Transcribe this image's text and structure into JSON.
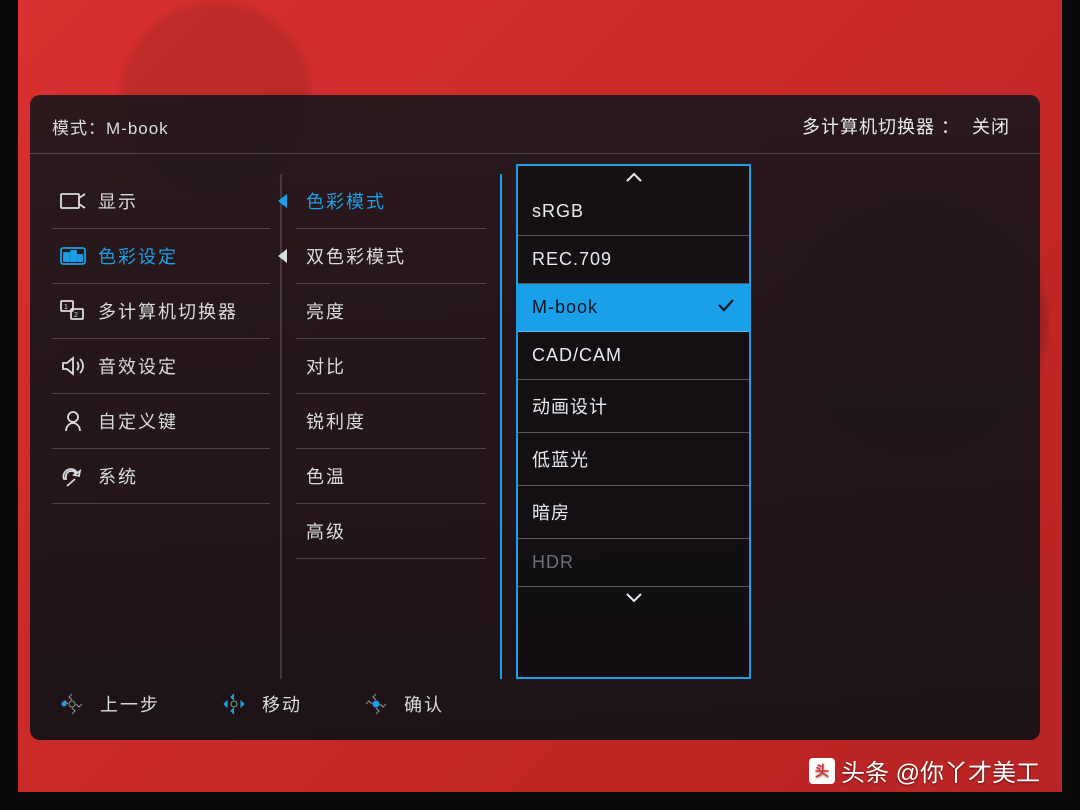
{
  "header": {
    "mode_prefix": "模式：",
    "mode_value": "M-book",
    "kvm_label": "多计算机切换器 ：",
    "kvm_value": "关闭"
  },
  "main_menu": [
    {
      "label": "显示",
      "icon": "display-icon"
    },
    {
      "label": "色彩设定",
      "icon": "color-icon"
    },
    {
      "label": "多计算机切换器",
      "icon": "kvm-icon"
    },
    {
      "label": "音效设定",
      "icon": "audio-icon"
    },
    {
      "label": "自定义键",
      "icon": "custom-key-icon"
    },
    {
      "label": "系统",
      "icon": "system-icon"
    }
  ],
  "main_menu_active": 1,
  "sub_menu": [
    "色彩模式",
    "双色彩模式",
    "亮度",
    "对比",
    "锐利度",
    "色温",
    "高级"
  ],
  "sub_menu_active": 0,
  "color_modes": [
    {
      "label": "sRGB"
    },
    {
      "label": "REC.709"
    },
    {
      "label": "M-book",
      "selected": true
    },
    {
      "label": "CAD/CAM"
    },
    {
      "label": "动画设计"
    },
    {
      "label": "低蓝光"
    },
    {
      "label": "暗房"
    },
    {
      "label": "HDR",
      "disabled": true
    }
  ],
  "footer": {
    "back": "上一步",
    "move": "移动",
    "confirm": "确认"
  },
  "watermark": "头条 @你丫才美工"
}
